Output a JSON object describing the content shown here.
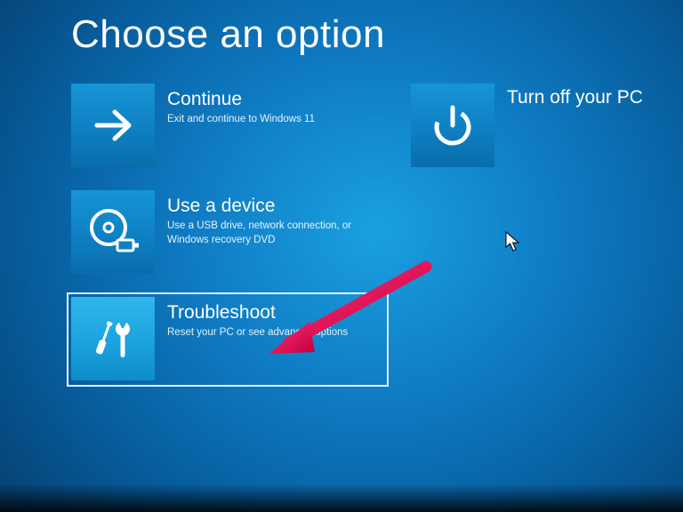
{
  "title": "Choose an option",
  "options": {
    "continue": {
      "title": "Continue",
      "desc": "Exit and continue to Windows 11"
    },
    "use_device": {
      "title": "Use a device",
      "desc": "Use a USB drive, network connection, or Windows recovery DVD"
    },
    "troubleshoot": {
      "title": "Troubleshoot",
      "desc": "Reset your PC or see advanced options"
    },
    "turn_off": {
      "title": "Turn off your PC"
    }
  }
}
